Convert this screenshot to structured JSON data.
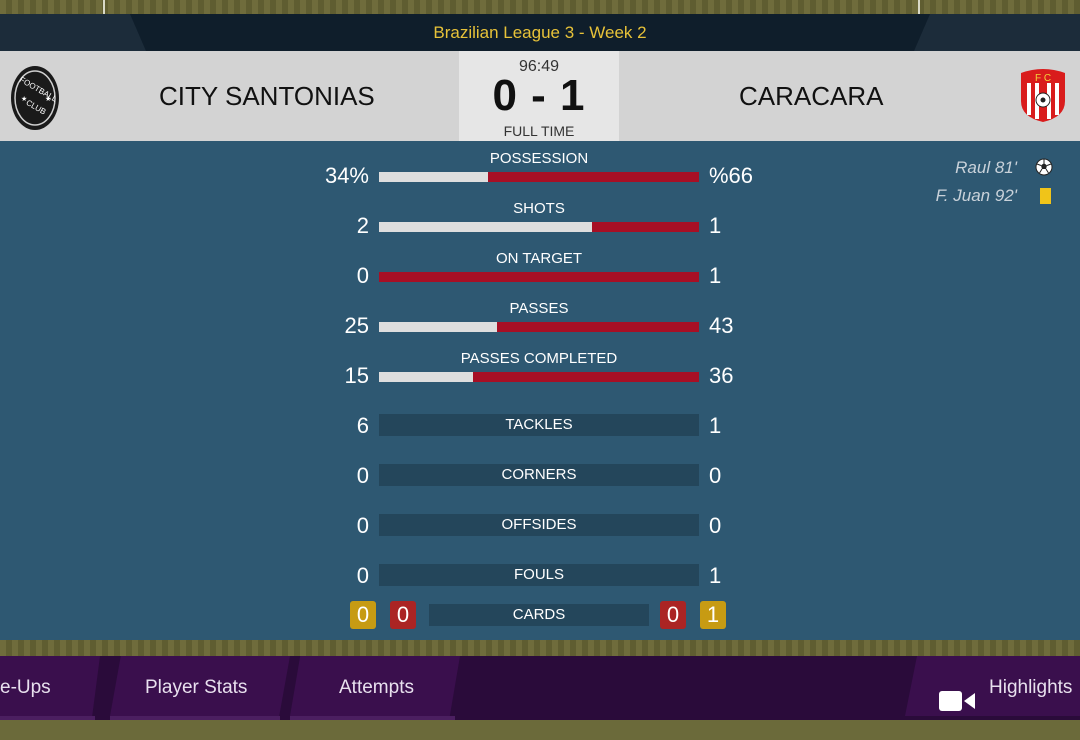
{
  "competition": "Brazilian League 3 - Week 2",
  "match": {
    "clock": "96:49",
    "score": "0 - 1",
    "status": "FULL TIME",
    "home_team": "CITY SANTONIAS",
    "away_team": "CARACARA",
    "home_crest_icon": "football-club-badge-icon",
    "away_crest_icon": "fc-shield-badge-icon"
  },
  "stats": [
    {
      "label": "POSSESSION",
      "home": "34%",
      "away": "%66",
      "home_share": 0.34,
      "bar": true
    },
    {
      "label": "SHOTS",
      "home": "2",
      "away": "1",
      "home_share": 0.667,
      "bar": true
    },
    {
      "label": "ON TARGET",
      "home": "0",
      "away": "1",
      "home_share": 0,
      "bar": true
    },
    {
      "label": "PASSES",
      "home": "25",
      "away": "43",
      "home_share": 0.368,
      "bar": true
    },
    {
      "label": "PASSES COMPLETED",
      "home": "15",
      "away": "36",
      "home_share": 0.294,
      "bar": true
    },
    {
      "label": "TACKLES",
      "home": "6",
      "away": "1",
      "bar": false
    },
    {
      "label": "CORNERS",
      "home": "0",
      "away": "0",
      "bar": false
    },
    {
      "label": "OFFSIDES",
      "home": "0",
      "away": "0",
      "bar": false
    },
    {
      "label": "FOULS",
      "home": "0",
      "away": "1",
      "bar": false
    }
  ],
  "cards": {
    "label": "CARDS",
    "home_yellow": "0",
    "home_red": "0",
    "away_red": "0",
    "away_yellow": "1"
  },
  "events": [
    {
      "text": "Raul 81'",
      "icon": "football-icon"
    },
    {
      "text": "F. Juan 92'",
      "icon": "yellow-card-icon"
    }
  ],
  "bottom_tabs": {
    "lineups": "e-Ups",
    "player_stats": "Player Stats",
    "attempts": "Attempts",
    "highlights": "Highlights",
    "highlights_icon": "video-camera-icon"
  },
  "colors": {
    "panel": "#2e5872",
    "home_bar": "#dedede",
    "away_bar": "#a70f25",
    "accent_gold": "#e7c239",
    "nav_bg": "#2a0b3a"
  }
}
